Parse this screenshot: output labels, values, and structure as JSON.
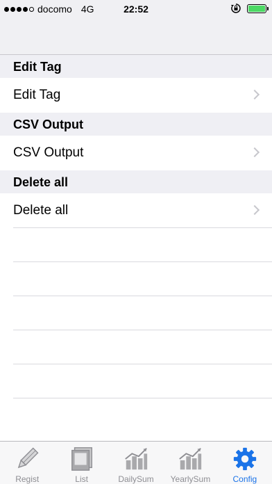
{
  "status_bar": {
    "signal_dots_filled": 4,
    "signal_dots_total": 5,
    "carrier": "docomo",
    "network": "4G",
    "time": "22:52",
    "battery_color": "#4cd964"
  },
  "sections": [
    {
      "header": "Edit Tag",
      "row_label": "Edit Tag"
    },
    {
      "header": "CSV Output",
      "row_label": "CSV Output"
    },
    {
      "header": "Delete all",
      "row_label": "Delete all"
    }
  ],
  "tabs": [
    {
      "label": "Regist",
      "icon": "pencil-icon"
    },
    {
      "label": "List",
      "icon": "list-icon"
    },
    {
      "label": "DailySum",
      "icon": "bar-chart-icon"
    },
    {
      "label": "YearlySum",
      "icon": "bar-chart-icon"
    },
    {
      "label": "Config",
      "icon": "gear-icon",
      "active": true
    }
  ],
  "colors": {
    "accent": "#1a73e8",
    "inactive_tab": "#8e8e93",
    "section_bg": "#efeff4"
  }
}
